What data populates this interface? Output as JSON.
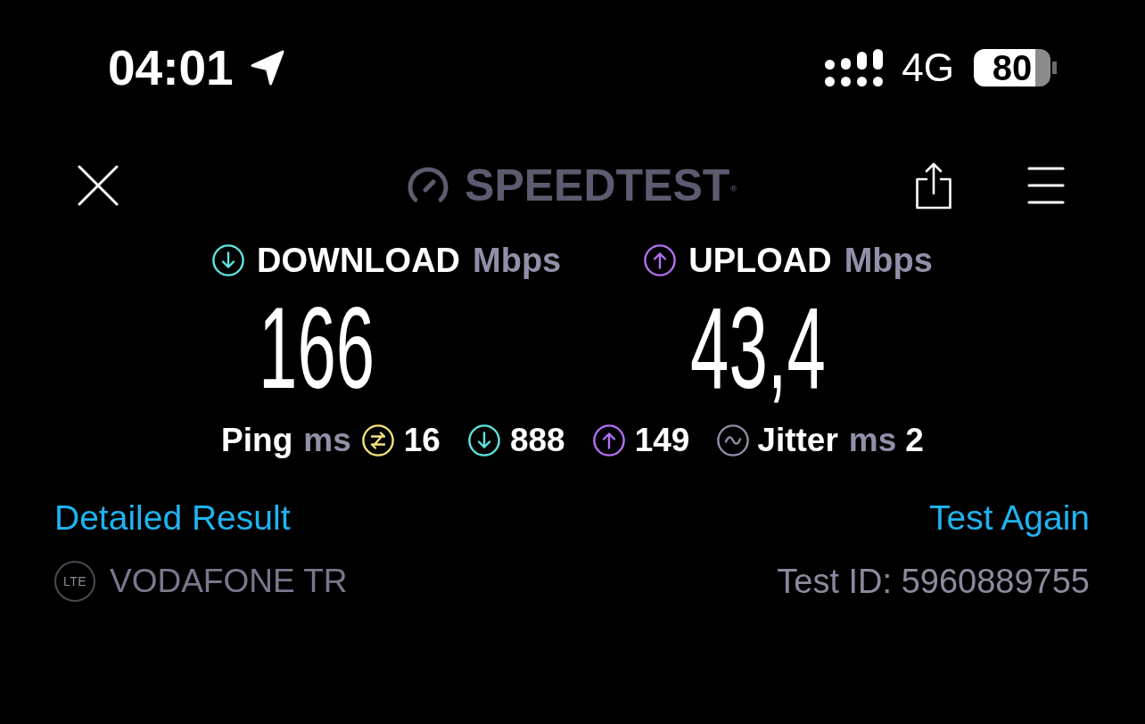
{
  "status_bar": {
    "time": "04:01",
    "network": "4G",
    "battery": "80"
  },
  "header": {
    "logo": "SPEEDTEST$^{®}$"
  },
  "results": [
    {
      "kind": "download",
      "label": "DOWNLOAD",
      "unit": "Mbps",
      "value": "166",
      "color": "#5de6e2"
    },
    {
      "kind": "upload",
      "label": "UPLOAD",
      "unit": "Mbps",
      "value": "43,4",
      "color": "#b46ff2"
    }
  ],
  "stats": [
    {
      "kind": "ping",
      "label": "Ping",
      "unit": "ms",
      "value": "16",
      "color": "#f6e27c"
    },
    {
      "kind": "download",
      "value": "888",
      "color": "#5de6e2"
    },
    {
      "kind": "upload",
      "value": "149",
      "color": "#b46ff2"
    },
    {
      "kind": "jitter",
      "label": "Jitter",
      "unit": "ms",
      "value": "2",
      "color": "#8e8ea4"
    }
  ],
  "links": {
    "detailed_result": "Detailed Result",
    "test_again": "Test Again"
  },
  "provider": {
    "network_type": "LTE",
    "name": "VODAFONE TR",
    "test_id": "Test ID: 5960889755"
  }
}
